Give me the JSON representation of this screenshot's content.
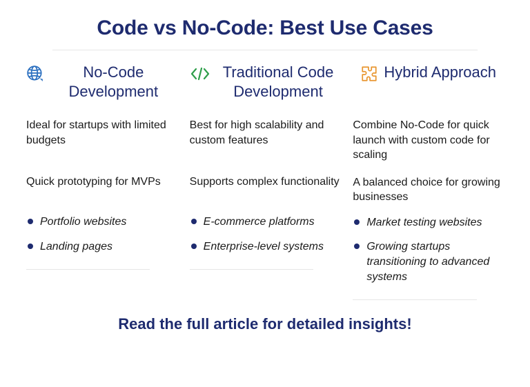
{
  "title": "Code vs No-Code: Best Use Cases",
  "columns": [
    {
      "heading": "No-Code Development",
      "desc1": "Ideal for startups with limited budgets",
      "desc2": "Quick prototyping for MVPs",
      "examples": [
        "Portfolio websites",
        "Landing pages"
      ]
    },
    {
      "heading": "Traditional Code Development",
      "desc1": "Best for high scalability and custom features",
      "desc2": "Supports complex functionality",
      "examples": [
        "E-commerce platforms",
        "Enterprise-level systems"
      ]
    },
    {
      "heading": "Hybrid Approach",
      "desc1": "Combine No-Code for quick launch with custom code for scaling",
      "desc2": "A balanced choice for growing businesses",
      "examples": [
        "Market testing websites",
        "Growing startups transitioning to advanced systems"
      ]
    }
  ],
  "cta": "Read the full article for detailed insights!"
}
